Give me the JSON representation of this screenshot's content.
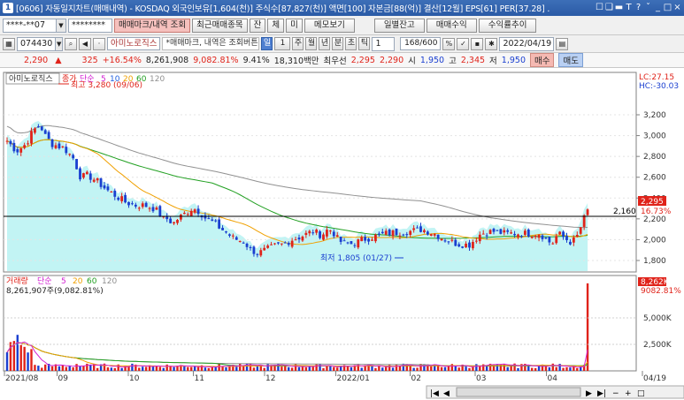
{
  "window": {
    "icon_label": "1",
    "title": "[0606] 자동일지차트(매매내역) - KOSDAQ 외국인보유[1,604(천)] 주식수[87,827(천)] 액면[100] 자본금[88(억)] 결산[12월] EPS[61] PER[37.28] .",
    "controls": [
      "☐",
      "❑",
      "▬",
      "T",
      "?",
      "ˇ",
      "_",
      "□",
      "×"
    ]
  },
  "toolbar1": {
    "account": "****-**07",
    "password": "********",
    "buttons": [
      "매매마크/내역 조회",
      "최근매매종목",
      "잔",
      "체",
      "미",
      "메모보기"
    ],
    "right_buttons": [
      "일별잔고",
      "매매수익",
      "수익률추이"
    ]
  },
  "toolbar2": {
    "code": "074430",
    "stock_name": "아미노로직스",
    "message": "*매매마크, 내역은 조회버튼 클릭",
    "periods": [
      "일",
      "1",
      "주",
      "월",
      "년",
      "분",
      "초",
      "틱"
    ],
    "period_selected": "일",
    "count_select": "1",
    "count": "168/600",
    "date": "2022/04/19"
  },
  "quote": {
    "price": "2,290",
    "arrow": "▲",
    "change": "325",
    "rate": "+16.54%",
    "volume": "8,261,908",
    "volume_rate": "9,082.81%",
    "turnover": "9.41%",
    "amount": "18,310백만",
    "best_label": "최우선",
    "best_ask": "2,295",
    "best_bid": "2,290",
    "open_label": "시",
    "open": "1,950",
    "high_label": "고",
    "high": "2,345",
    "low_label": "저",
    "low": "1,950",
    "buy_label": "매수",
    "sell_label": "매도"
  },
  "price_panel": {
    "stock_tag": "아미노로직스",
    "legend_close": "종가",
    "legend_simple": "단순",
    "ma": [
      "5",
      "10",
      "20",
      "60",
      "120"
    ],
    "lc": "LC:27.15",
    "hc": "HC:-30.03",
    "y_ticks": [
      "3,200",
      "3,000",
      "2,800",
      "2,600",
      "2,400",
      "2,200",
      "2,000",
      "1,800"
    ],
    "y_values": [
      3200,
      3000,
      2800,
      2600,
      2400,
      2200,
      2000,
      1800
    ],
    "current_price": "2,295",
    "current_rate": "16.73%",
    "hline_value": "2,160",
    "high_note": "최고 3,280 (09/06)",
    "low_note": "최저 1,805 (01/27)"
  },
  "volume_panel": {
    "title": "거래량",
    "legend_simple": "단순",
    "ma": [
      "5",
      "20",
      "60",
      "120"
    ],
    "value_text": "8,261,907주(9,082.81%)",
    "current_vol": "8,262K",
    "current_rate": "9082.81%",
    "y_ticks": [
      "5,000K",
      "2,500K"
    ],
    "y_values": [
      5000,
      2500
    ]
  },
  "x_labels": [
    "2021/08",
    "09",
    "10",
    "11",
    "12",
    "2022/01",
    "02",
    "03",
    "04",
    "04/19"
  ],
  "colors": {
    "up": "#e0231a",
    "down": "#1a3fd0",
    "ma5": "#d21fd2",
    "ma10": "#1f5fe0",
    "ma20": "#f0a000",
    "ma60": "#22a022",
    "ma120": "#909090",
    "fill": "#c2f4f4"
  }
}
